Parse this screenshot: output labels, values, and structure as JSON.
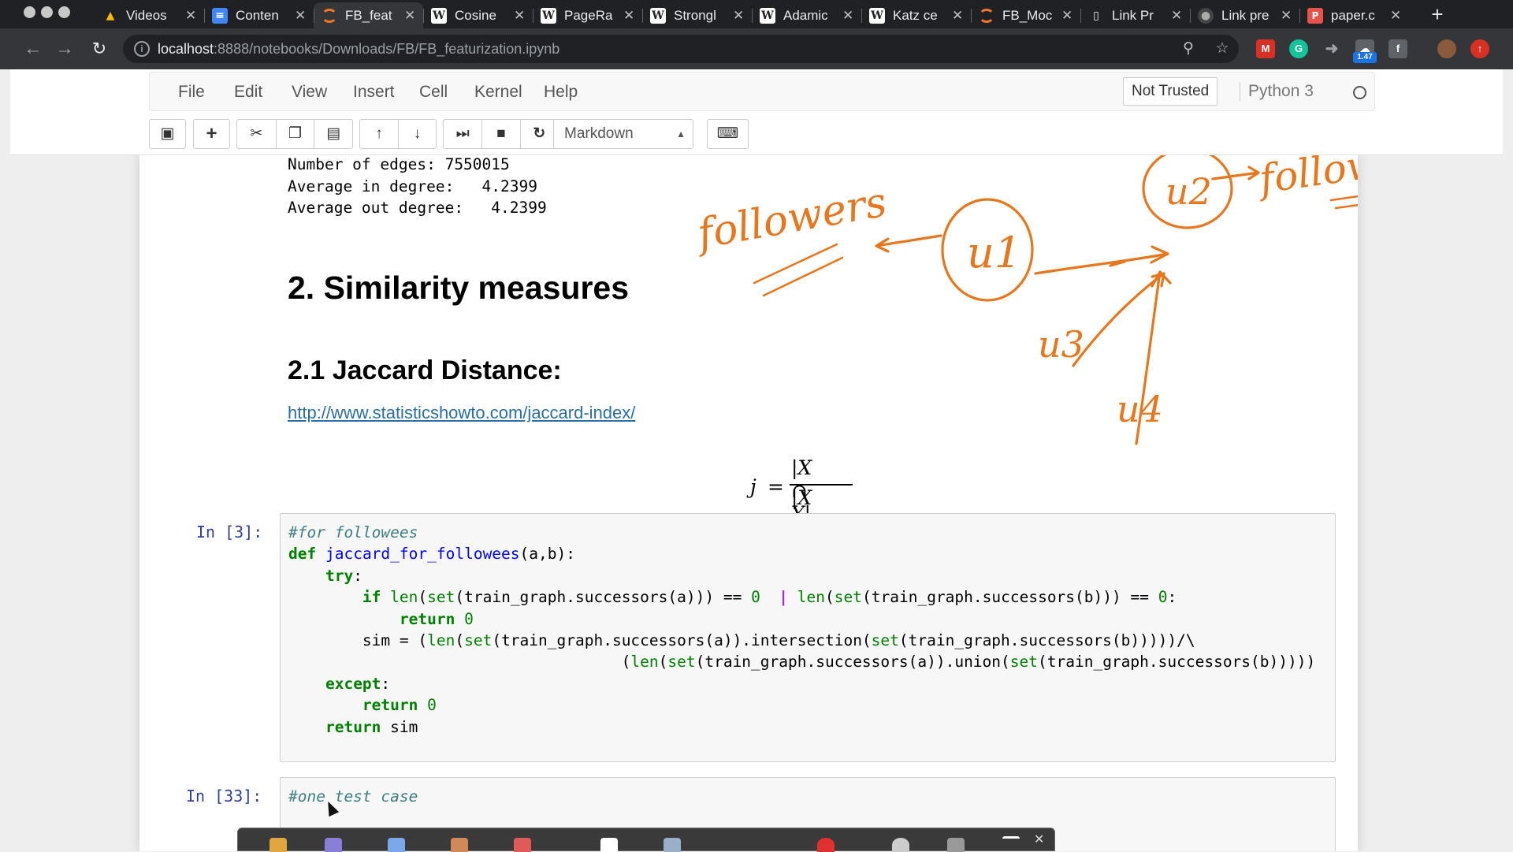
{
  "browser": {
    "tabs": [
      {
        "label": "Videos",
        "favicon": "drive-icon",
        "active": false
      },
      {
        "label": "Conten",
        "favicon": "docs-icon",
        "active": false
      },
      {
        "label": "FB_feat",
        "favicon": "jupyter-icon",
        "active": true
      },
      {
        "label": "Cosine",
        "favicon": "wikipedia-icon",
        "active": false
      },
      {
        "label": "PageRa",
        "favicon": "wikipedia-icon",
        "active": false
      },
      {
        "label": "Strongl",
        "favicon": "wikipedia-icon",
        "active": false
      },
      {
        "label": "Adamic",
        "favicon": "wikipedia-icon",
        "active": false
      },
      {
        "label": "Katz ce",
        "favicon": "wikipedia-icon",
        "active": false
      },
      {
        "label": "FB_Moc",
        "favicon": "jupyter-icon",
        "active": false
      },
      {
        "label": "Link Pr",
        "favicon": "file-icon",
        "active": false
      },
      {
        "label": "Link pre",
        "favicon": "github-icon",
        "active": false
      },
      {
        "label": "paper.c",
        "favicon": "pdf-icon",
        "active": false
      }
    ],
    "url_host": "localhost",
    "url_path": ":8888/notebooks/Downloads/FB/FB_featurization.ipynb",
    "extension_badge": "1.47"
  },
  "jupyter": {
    "menu": [
      "File",
      "Edit",
      "View",
      "Insert",
      "Cell",
      "Kernel",
      "Help"
    ],
    "trust_status": "Not Trusted",
    "kernel_name": "Python 3",
    "cell_type": "Markdown"
  },
  "notebook": {
    "output_lines": [
      "Number of edges: 7550015",
      "Average in degree:   4.2399",
      "Average out degree:   4.2399"
    ],
    "heading": "2. Similarity measures",
    "subheading": "2.1 Jaccard Distance:",
    "link": "http://www.statisticshowto.com/jaccard-index/",
    "formula": {
      "lhs": "j",
      "eq": "=",
      "numerator": "|X ∩ Y|",
      "denominator": "|X ∪ Y|"
    },
    "cell3_prompt": "In [3]:",
    "cell33_prompt": "In [33]:",
    "cell33_comment": "#one test case"
  },
  "annotations": {
    "followers": "followers",
    "followee": "followee",
    "u1": "u1",
    "u2": "u2",
    "u3": "u3",
    "u4": "u4",
    "color": "#e8761c"
  }
}
